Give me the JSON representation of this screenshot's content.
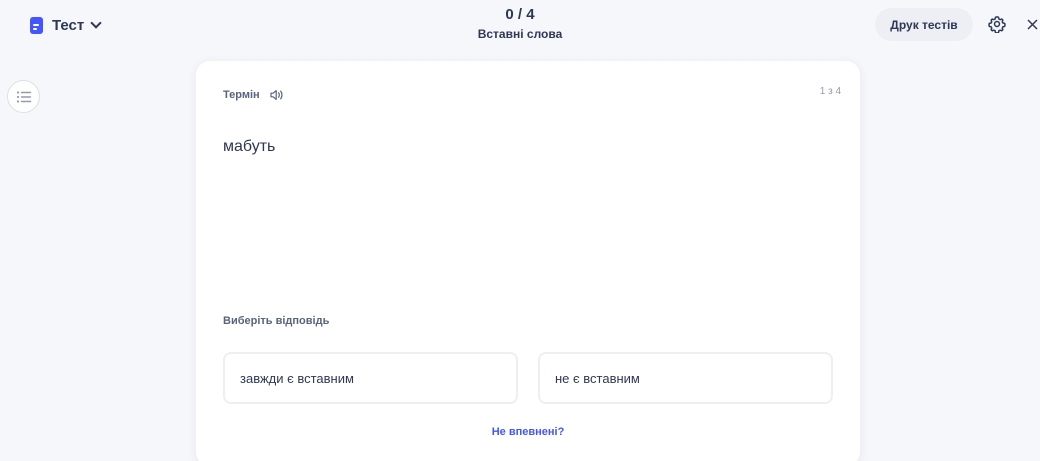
{
  "header": {
    "mode_label": "Тест",
    "progress": "0 / 4",
    "set_title": "Вставні слова",
    "print_button": "Друк тестів",
    "mode_icon": "study-set-icon",
    "settings_icon": "gear-icon",
    "close_icon": "close-icon"
  },
  "sidebar": {
    "toc_icon": "list-icon"
  },
  "card": {
    "term_label": "Термін",
    "audio_icon": "speaker-icon",
    "counter": "1 з 4",
    "term": "мабуть",
    "prompt": "Виберіть відповідь",
    "options": [
      "завжди є вставним",
      "не є вставним"
    ],
    "not_sure": "Не впевнені?"
  },
  "colors": {
    "accent": "#4255ff",
    "background": "#f6f7fb",
    "text": "#2e3856",
    "muted": "#586380",
    "border": "#edeff4"
  }
}
